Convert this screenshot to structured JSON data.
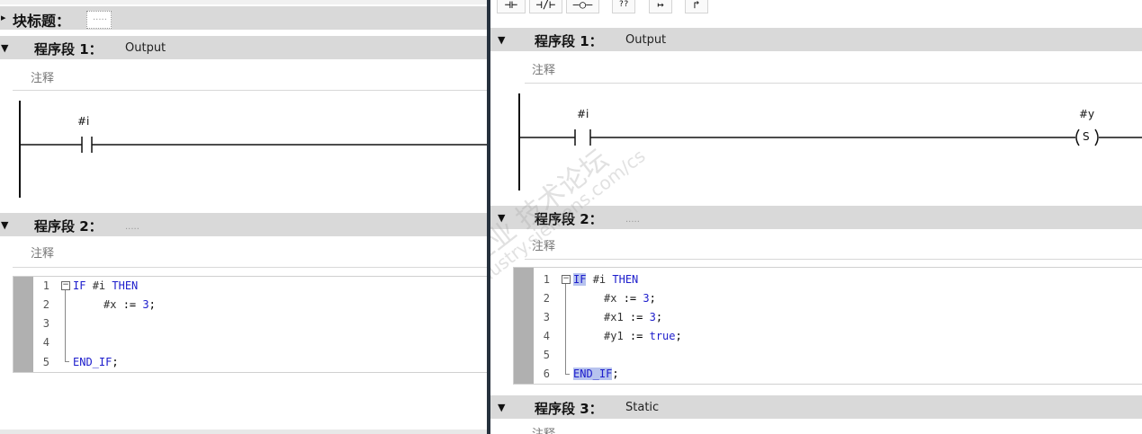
{
  "left": {
    "block_title": {
      "label": "块标题：",
      "dots": "....."
    },
    "network1": {
      "title": "程序段 1：",
      "subtitle": "Output",
      "comment": "注释",
      "contact_var": "#i"
    },
    "network2": {
      "title": "程序段 2：",
      "dots": ".....",
      "comment": "注释",
      "line_numbers": [
        "1",
        "2",
        "3",
        "4",
        "5"
      ],
      "code": {
        "if": "IF",
        "cond": "#i",
        "then": "THEN",
        "assign_var": "#x",
        "assign_op": ":=",
        "assign_val": "3",
        "assign_end": ";",
        "endif": "END_IF",
        "endif_semi": ";"
      }
    }
  },
  "right": {
    "toolbar": {
      "btn1": "⊣⊢",
      "btn2": "⊣/⊢",
      "btn3": "–○–",
      "btn4": "??",
      "btn5": "↦",
      "btn6": "↱"
    },
    "network1": {
      "title": "程序段 1：",
      "subtitle": "Output",
      "comment": "注释",
      "contact_var": "#i",
      "coil_var": "#y",
      "coil_label": "S"
    },
    "network2": {
      "title": "程序段 2：",
      "dots": ".....",
      "comment": "注释",
      "line_numbers": [
        "1",
        "2",
        "3",
        "4",
        "5",
        "6"
      ],
      "code": {
        "if": "IF",
        "cond": "#i",
        "then": "THEN",
        "l2_var": "#x",
        "l2_val": "3",
        "l3_var": "#x1",
        "l3_val": "3",
        "l4_var": "#y1",
        "l4_val": "true",
        "op": ":=",
        "semi": ";",
        "endif": "END_IF"
      }
    },
    "network3": {
      "title": "程序段 3：",
      "subtitle": "Static",
      "comment": "注释"
    }
  },
  "watermark": {
    "line1": "西门子工业 技术论坛",
    "line2": "support.industry.siemens.com/cs"
  }
}
